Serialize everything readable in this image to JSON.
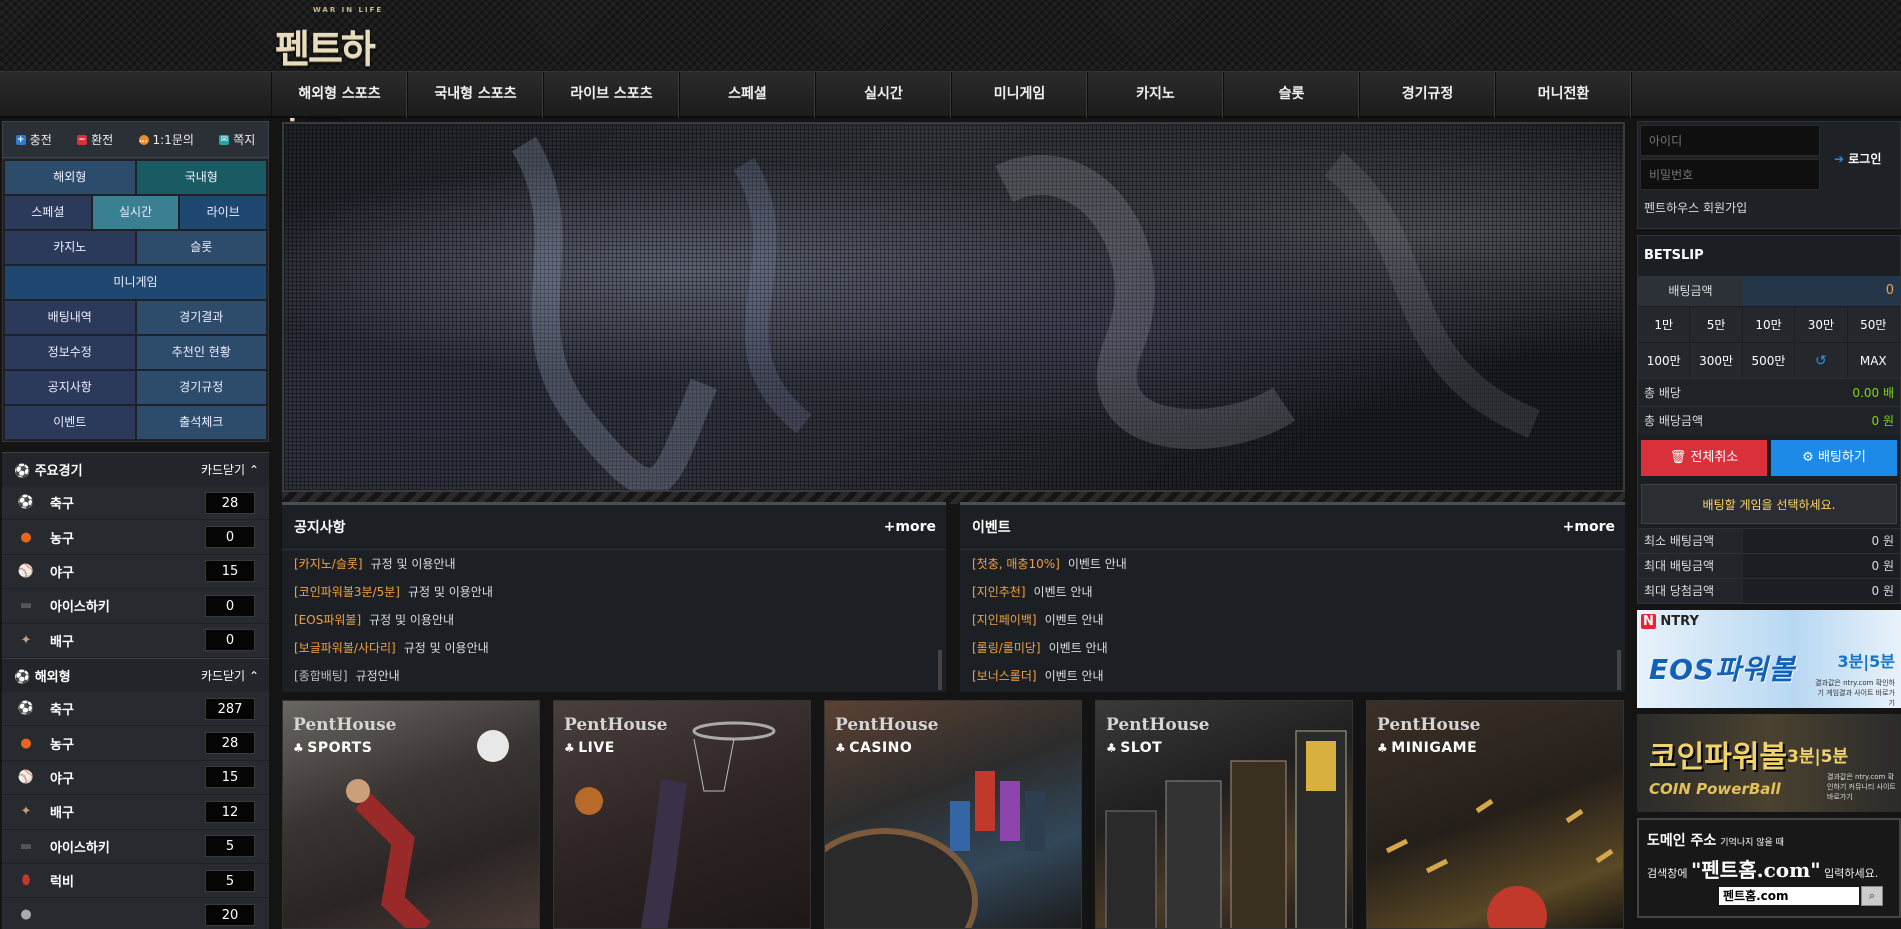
{
  "logo": {
    "tagline": "WAR IN LIFE",
    "name": "펜트하우스"
  },
  "nav": [
    "해외형 스포츠",
    "국내형 스포츠",
    "라이브 스포츠",
    "스페셜",
    "실시간",
    "미니게임",
    "카지노",
    "슬롯",
    "경기규정",
    "머니전환"
  ],
  "quick": {
    "charge": "충전",
    "withdraw": "환전",
    "inquiry": "1:1문의",
    "message": "쪽지"
  },
  "menu": {
    "overseas": "해외형",
    "domestic": "국내형",
    "special": "스페셜",
    "realtime": "실시간",
    "live": "라이브",
    "casino": "카지노",
    "slot": "슬롯",
    "minigame": "미니게임",
    "bet_history": "배팅내역",
    "game_results": "경기결과",
    "edit_info": "정보수정",
    "referrals": "추천인 현황",
    "notice": "공지사항",
    "rules": "경기규정",
    "event": "이벤트",
    "attendance": "출석체크"
  },
  "major": {
    "title": "주요경기",
    "close": "카드닫기",
    "sports": [
      {
        "name": "축구",
        "count": "28"
      },
      {
        "name": "농구",
        "count": "0"
      },
      {
        "name": "야구",
        "count": "15"
      },
      {
        "name": "아이스하키",
        "count": "0"
      },
      {
        "name": "배구",
        "count": "0"
      }
    ]
  },
  "overseas": {
    "title": "해외형",
    "close": "카드닫기",
    "sports": [
      {
        "name": "축구",
        "count": "287"
      },
      {
        "name": "농구",
        "count": "28"
      },
      {
        "name": "야구",
        "count": "15"
      },
      {
        "name": "배구",
        "count": "12"
      },
      {
        "name": "아이스하키",
        "count": "5"
      },
      {
        "name": "럭비",
        "count": "5"
      },
      {
        "name": "",
        "count": "20"
      }
    ]
  },
  "notice_board": {
    "title": "공지사항",
    "more": "+more",
    "items": [
      {
        "cat": "[카지노/슬롯]",
        "text": "규정 및 이용안내"
      },
      {
        "cat": "[코인파워볼3분/5분]",
        "text": "규정 및 이용안내"
      },
      {
        "cat": "[EOS파워볼]",
        "text": "규정 및 이용안내"
      },
      {
        "cat": "[보글파워볼/사다리]",
        "text": "규정 및 이용안내"
      },
      {
        "cat": "[종합배팅]",
        "text": "규정안내"
      }
    ]
  },
  "event_board": {
    "title": "이벤트",
    "more": "+more",
    "items": [
      {
        "cat": "[첫충, 매충10%]",
        "text": "이벤트 안내"
      },
      {
        "cat": "[지인추천]",
        "text": "이벤트 안내"
      },
      {
        "cat": "[지인페이백]",
        "text": "이벤트 안내"
      },
      {
        "cat": "[롤링/롤미당]",
        "text": "이벤트 안내"
      },
      {
        "cat": "[보너스롤더]",
        "text": "이벤트 안내"
      }
    ]
  },
  "cards": [
    {
      "brand": "PentHouse",
      "cat": "SPORTS"
    },
    {
      "brand": "PentHouse",
      "cat": "LIVE"
    },
    {
      "brand": "PentHouse",
      "cat": "CASINO"
    },
    {
      "brand": "PentHouse",
      "cat": "SLOT"
    },
    {
      "brand": "PentHouse",
      "cat": "MINIGAME"
    }
  ],
  "login": {
    "id_placeholder": "아이디",
    "pw_placeholder": "비밀번호",
    "login": "로그인",
    "join": "펜트하우스 회원가입"
  },
  "betslip": {
    "title": "BETSLIP",
    "amount_label": "배팅금액",
    "amount": "0",
    "chips": [
      "1만",
      "5만",
      "10만",
      "30만",
      "50만",
      "100만",
      "300만",
      "500만",
      "↺",
      "MAX"
    ],
    "total_odds_label": "총 배당",
    "total_odds": "0.00 배",
    "total_payout_label": "총 배당금액",
    "total_payout": "0 원",
    "cancel_all": "전체취소",
    "place_bet": "배팅하기",
    "note": "배팅할 게임을 선택하세요.",
    "limits": [
      {
        "label": "최소 배팅금액",
        "value": "0 원"
      },
      {
        "label": "최대 배팅금액",
        "value": "0 원"
      },
      {
        "label": "최대 당첨금액",
        "value": "0 원"
      }
    ]
  },
  "ads": {
    "eos": {
      "brand": "NTRY",
      "title": "EOS파워볼",
      "mins": "3분|5분",
      "sub": "결과값은 ntry.com 확인하기 게임결과 사이트 바로가기"
    },
    "coin": {
      "title": "코인파워볼",
      "mins": "3분|5분",
      "eng": "COIN PowerBall",
      "sub": "결과값은 ntry.com 확인하기 커뮤니티 사이트 바로가기"
    },
    "domain": {
      "title": "도메인 주소",
      "title_small": "기억나지 않을 때",
      "line_pre": "검색창에",
      "line_big": "\"펜트홈.com\"",
      "line_post": "입력하세요.",
      "box": "펜트홈.com"
    }
  }
}
